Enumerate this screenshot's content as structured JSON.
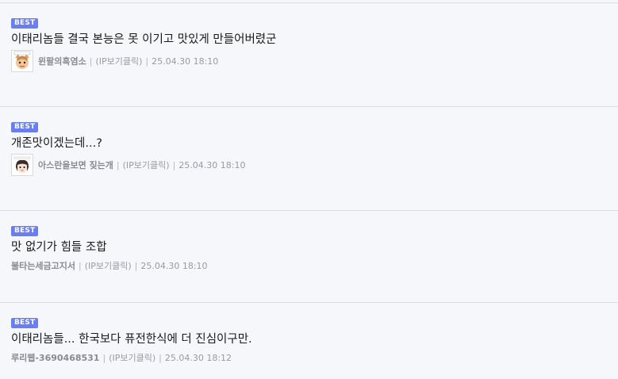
{
  "comments": [
    {
      "badge": "BEST",
      "text": "이태리놈들 결국 본능은 못 이기고 맛있게 만들어버렸군",
      "nickname": "윈팔의흑염소",
      "separator": "|",
      "ip_label": "(IP보기클릭)",
      "date": "25.04.30 18:10",
      "has_avatar": true,
      "avatar_icon": "goat-character-avatar"
    },
    {
      "badge": "BEST",
      "text": "개존맛이겠는데...?",
      "nickname": "아스란을보면 짖는개",
      "separator": "|",
      "ip_label": "(IP보기클릭)",
      "date": "25.04.30 18:10",
      "has_avatar": true,
      "avatar_icon": "anime-girl-avatar"
    },
    {
      "badge": "BEST",
      "text": "맛 없기가 힘들 조합",
      "nickname": "불타는세금고지서",
      "separator": "|",
      "ip_label": "(IP보기클릭)",
      "date": "25.04.30 18:10",
      "has_avatar": false
    },
    {
      "badge": "BEST",
      "text": "이태리놈들... 한국보다 퓨전한식에 더 진심이구만.",
      "nickname": "루리웹-3690468531",
      "separator": "|",
      "ip_label": "(IP보기클릭)",
      "date": "25.04.30 18:12",
      "has_avatar": false
    }
  ],
  "colors": {
    "badge_bg": "#6b7ef0",
    "background": "#f6f7fb",
    "divider": "#dcdde3"
  }
}
